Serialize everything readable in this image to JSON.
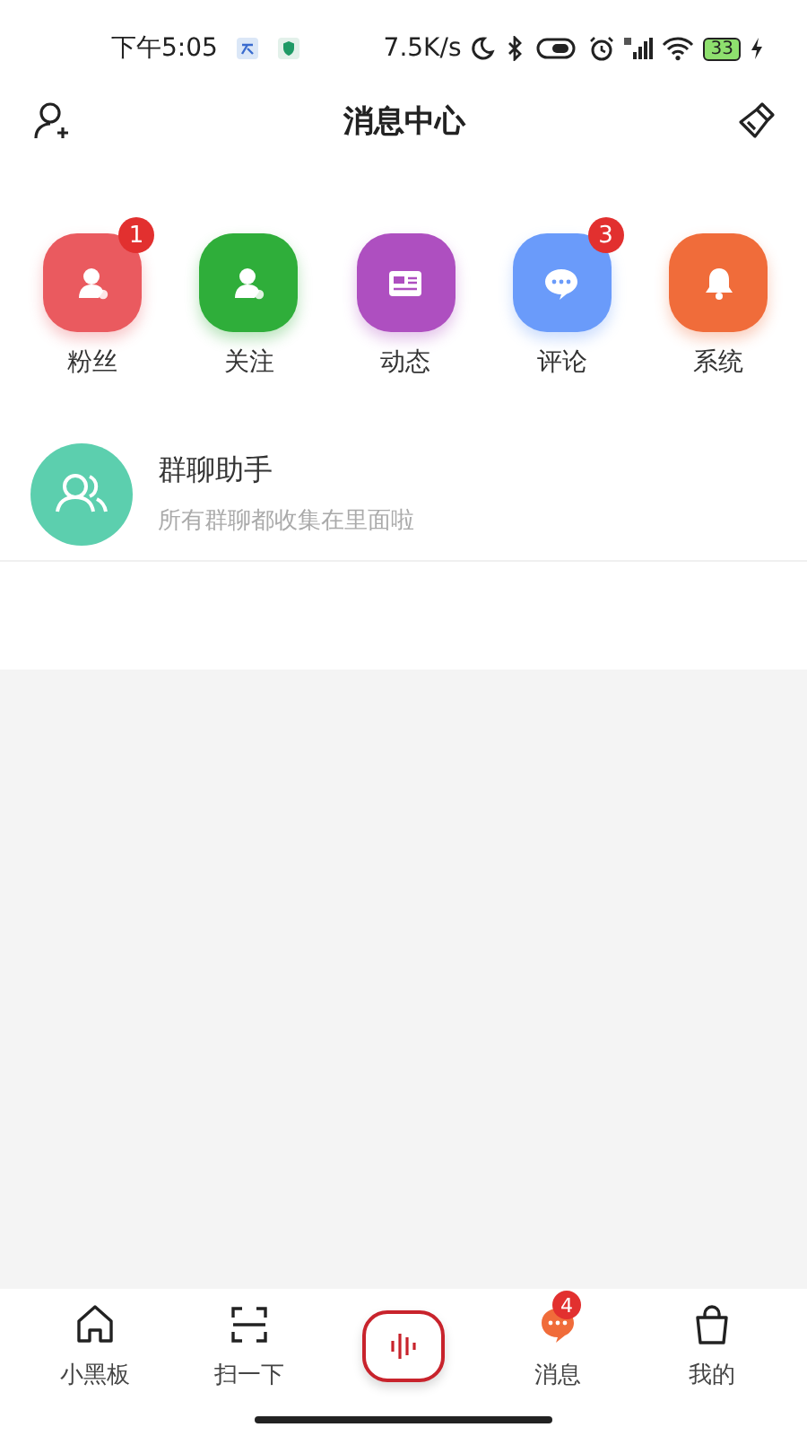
{
  "status_bar": {
    "time": "下午5:05",
    "speed": "7.5K/s",
    "battery": "33"
  },
  "header": {
    "title": "消息中心"
  },
  "categories": [
    {
      "kind": "fans",
      "label": "粉丝",
      "color": "#ea5a5f",
      "badge": "1"
    },
    {
      "kind": "follow",
      "label": "关注",
      "color": "#2fae3a"
    },
    {
      "kind": "feed",
      "label": "动态",
      "color": "#ae4fc0"
    },
    {
      "kind": "comment",
      "label": "评论",
      "color": "#6a9bfa",
      "badge": "3"
    },
    {
      "kind": "system",
      "label": "系统",
      "color": "#f06c3a"
    }
  ],
  "group_assistant": {
    "title": "群聊助手",
    "subtitle": "所有群聊都收集在里面啦"
  },
  "bottom_nav": [
    {
      "kind": "home",
      "label": "小黑板"
    },
    {
      "kind": "scan",
      "label": "扫一下"
    },
    {
      "kind": "record"
    },
    {
      "kind": "message",
      "label": "消息",
      "badge": "4"
    },
    {
      "kind": "me",
      "label": "我的"
    }
  ]
}
